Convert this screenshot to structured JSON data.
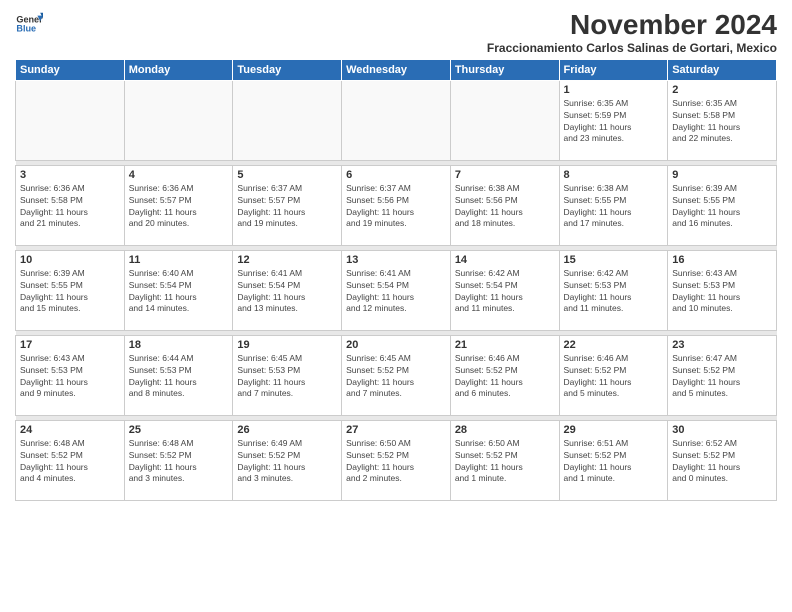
{
  "logo": {
    "line1": "General",
    "line2": "Blue"
  },
  "title": "November 2024",
  "subtitle": "Fraccionamiento Carlos Salinas de Gortari, Mexico",
  "weekdays": [
    "Sunday",
    "Monday",
    "Tuesday",
    "Wednesday",
    "Thursday",
    "Friday",
    "Saturday"
  ],
  "weeks": [
    [
      {
        "day": "",
        "info": ""
      },
      {
        "day": "",
        "info": ""
      },
      {
        "day": "",
        "info": ""
      },
      {
        "day": "",
        "info": ""
      },
      {
        "day": "",
        "info": ""
      },
      {
        "day": "1",
        "info": "Sunrise: 6:35 AM\nSunset: 5:59 PM\nDaylight: 11 hours\nand 23 minutes."
      },
      {
        "day": "2",
        "info": "Sunrise: 6:35 AM\nSunset: 5:58 PM\nDaylight: 11 hours\nand 22 minutes."
      }
    ],
    [
      {
        "day": "3",
        "info": "Sunrise: 6:36 AM\nSunset: 5:58 PM\nDaylight: 11 hours\nand 21 minutes."
      },
      {
        "day": "4",
        "info": "Sunrise: 6:36 AM\nSunset: 5:57 PM\nDaylight: 11 hours\nand 20 minutes."
      },
      {
        "day": "5",
        "info": "Sunrise: 6:37 AM\nSunset: 5:57 PM\nDaylight: 11 hours\nand 19 minutes."
      },
      {
        "day": "6",
        "info": "Sunrise: 6:37 AM\nSunset: 5:56 PM\nDaylight: 11 hours\nand 19 minutes."
      },
      {
        "day": "7",
        "info": "Sunrise: 6:38 AM\nSunset: 5:56 PM\nDaylight: 11 hours\nand 18 minutes."
      },
      {
        "day": "8",
        "info": "Sunrise: 6:38 AM\nSunset: 5:55 PM\nDaylight: 11 hours\nand 17 minutes."
      },
      {
        "day": "9",
        "info": "Sunrise: 6:39 AM\nSunset: 5:55 PM\nDaylight: 11 hours\nand 16 minutes."
      }
    ],
    [
      {
        "day": "10",
        "info": "Sunrise: 6:39 AM\nSunset: 5:55 PM\nDaylight: 11 hours\nand 15 minutes."
      },
      {
        "day": "11",
        "info": "Sunrise: 6:40 AM\nSunset: 5:54 PM\nDaylight: 11 hours\nand 14 minutes."
      },
      {
        "day": "12",
        "info": "Sunrise: 6:41 AM\nSunset: 5:54 PM\nDaylight: 11 hours\nand 13 minutes."
      },
      {
        "day": "13",
        "info": "Sunrise: 6:41 AM\nSunset: 5:54 PM\nDaylight: 11 hours\nand 12 minutes."
      },
      {
        "day": "14",
        "info": "Sunrise: 6:42 AM\nSunset: 5:54 PM\nDaylight: 11 hours\nand 11 minutes."
      },
      {
        "day": "15",
        "info": "Sunrise: 6:42 AM\nSunset: 5:53 PM\nDaylight: 11 hours\nand 11 minutes."
      },
      {
        "day": "16",
        "info": "Sunrise: 6:43 AM\nSunset: 5:53 PM\nDaylight: 11 hours\nand 10 minutes."
      }
    ],
    [
      {
        "day": "17",
        "info": "Sunrise: 6:43 AM\nSunset: 5:53 PM\nDaylight: 11 hours\nand 9 minutes."
      },
      {
        "day": "18",
        "info": "Sunrise: 6:44 AM\nSunset: 5:53 PM\nDaylight: 11 hours\nand 8 minutes."
      },
      {
        "day": "19",
        "info": "Sunrise: 6:45 AM\nSunset: 5:53 PM\nDaylight: 11 hours\nand 7 minutes."
      },
      {
        "day": "20",
        "info": "Sunrise: 6:45 AM\nSunset: 5:52 PM\nDaylight: 11 hours\nand 7 minutes."
      },
      {
        "day": "21",
        "info": "Sunrise: 6:46 AM\nSunset: 5:52 PM\nDaylight: 11 hours\nand 6 minutes."
      },
      {
        "day": "22",
        "info": "Sunrise: 6:46 AM\nSunset: 5:52 PM\nDaylight: 11 hours\nand 5 minutes."
      },
      {
        "day": "23",
        "info": "Sunrise: 6:47 AM\nSunset: 5:52 PM\nDaylight: 11 hours\nand 5 minutes."
      }
    ],
    [
      {
        "day": "24",
        "info": "Sunrise: 6:48 AM\nSunset: 5:52 PM\nDaylight: 11 hours\nand 4 minutes."
      },
      {
        "day": "25",
        "info": "Sunrise: 6:48 AM\nSunset: 5:52 PM\nDaylight: 11 hours\nand 3 minutes."
      },
      {
        "day": "26",
        "info": "Sunrise: 6:49 AM\nSunset: 5:52 PM\nDaylight: 11 hours\nand 3 minutes."
      },
      {
        "day": "27",
        "info": "Sunrise: 6:50 AM\nSunset: 5:52 PM\nDaylight: 11 hours\nand 2 minutes."
      },
      {
        "day": "28",
        "info": "Sunrise: 6:50 AM\nSunset: 5:52 PM\nDaylight: 11 hours\nand 1 minute."
      },
      {
        "day": "29",
        "info": "Sunrise: 6:51 AM\nSunset: 5:52 PM\nDaylight: 11 hours\nand 1 minute."
      },
      {
        "day": "30",
        "info": "Sunrise: 6:52 AM\nSunset: 5:52 PM\nDaylight: 11 hours\nand 0 minutes."
      }
    ]
  ]
}
